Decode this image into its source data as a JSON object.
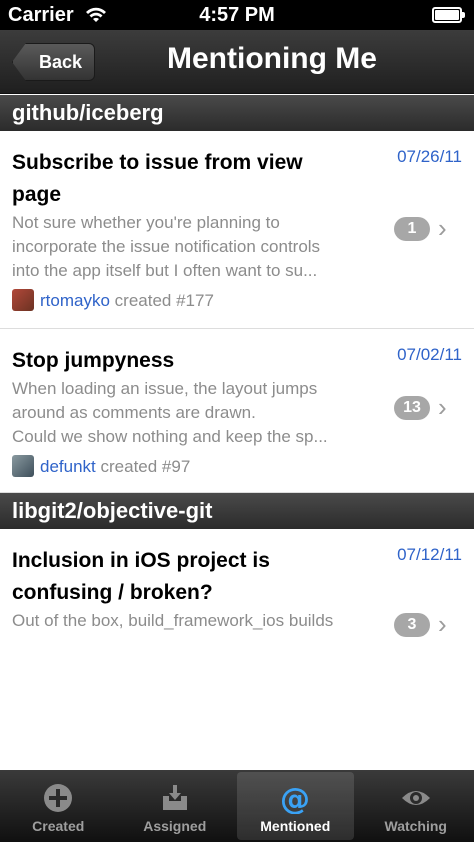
{
  "status_bar": {
    "carrier": "Carrier",
    "time": "4:57 PM",
    "icons": [
      "wifi-icon",
      "battery-icon"
    ]
  },
  "nav": {
    "back_label": "Back",
    "title": "Mentioning Me"
  },
  "sections": [
    {
      "repo": "github/iceberg",
      "issues": [
        {
          "title_line1": "Subscribe to issue from view",
          "title_line2": "page",
          "date": "07/26/11",
          "body_lines": [
            "Not sure whether you're planning to",
            "incorporate the issue notification controls",
            "into the app itself but I often want to su..."
          ],
          "comment_count": "1",
          "author": "rtomayko",
          "action": "created #177"
        },
        {
          "title_line1": "Stop jumpyness",
          "date": "07/02/11",
          "body_lines": [
            "When loading an issue, the layout jumps",
            "around as comments are drawn.",
            "Could we show nothing and keep the sp..."
          ],
          "comment_count": "13",
          "author": "defunkt",
          "action": "created #97"
        }
      ]
    },
    {
      "repo": "libgit2/objective-git",
      "issues": [
        {
          "title_line1": "Inclusion in iOS project is",
          "title_line2": "confusing / broken?",
          "date": "07/12/11",
          "body_lines": [
            "Out of the box, build_framework_ios builds"
          ],
          "comment_count": "3"
        }
      ]
    }
  ],
  "tabs": [
    {
      "label": "Created",
      "icon": "plus-circle-icon",
      "active": false
    },
    {
      "label": "Assigned",
      "icon": "inbox-tray-icon",
      "active": false
    },
    {
      "label": "Mentioned",
      "icon": "at-sign-icon",
      "active": true
    },
    {
      "label": "Watching",
      "icon": "eye-icon",
      "active": false
    }
  ],
  "colors": {
    "link_blue": "#2f63c9",
    "active_tab_icon": "#3aa2f5",
    "badge_gray": "#a7a7a7"
  }
}
